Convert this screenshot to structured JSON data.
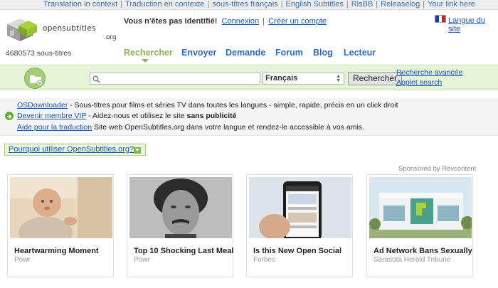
{
  "topbar": {
    "links": [
      "Translation in context",
      "Traduction en contexte",
      "sous-titres français",
      "English Subtitles",
      "RlsBB",
      "Releaselog",
      "Your link here"
    ]
  },
  "header": {
    "brand": "opensubtitles",
    "brand_suffix": ".org",
    "subtitle_count": "4680573 sous-titres",
    "not_identified": "Vous n'êtes pas identifié!",
    "login": "Connexion",
    "separator": "|",
    "create_account": "Créer un compte",
    "site_language": "Langue du site",
    "flag_colors": [
      "#1f3e9c",
      "#ffffff",
      "#d21f2a"
    ]
  },
  "nav": {
    "items": [
      "Rechercher",
      "Envoyer",
      "Demande",
      "Forum",
      "Blog",
      "Lecteur"
    ],
    "active_index": 0
  },
  "search": {
    "placeholder": "",
    "language": "Français",
    "button": "Rechercher",
    "advanced": "Recherche avancée",
    "applet": "Applet search"
  },
  "promo": {
    "osdownloader_link": "OSDownloader",
    "osdownloader_text": " - Sous-titres pour films et séries TV dans toutes les langues - simple, rapide, précis en un click droit",
    "vip_link": "Devenir membre VIP",
    "vip_text": " - Aidez-nous et utilisez le site ",
    "vip_bold": "sans publicité",
    "translate_link": "Aide pour la traduction",
    "translate_text": " Site web OpenSubtitles.org dans votre langue et rendez-le accessible à vos amis."
  },
  "why": {
    "label": "Pourquoi utiliser OpenSubtitles.org?"
  },
  "ads": {
    "sponsored": "Sponsored by Revcontent",
    "cards": [
      {
        "title": "Heartwarming Moment",
        "source": "Powr"
      },
      {
        "title": "Top 10 Shocking Last Meal",
        "source": "Powr"
      },
      {
        "title": "Is this New Open Social",
        "source": "Forbes"
      },
      {
        "title": "Ad Network Bans Sexually",
        "source": "Sarasota Herald Tribune"
      }
    ]
  },
  "colors": {
    "accent_green": "#8cb451",
    "link_blue": "#2d6cbf",
    "search_bar_bg": "#e5f4d7"
  }
}
